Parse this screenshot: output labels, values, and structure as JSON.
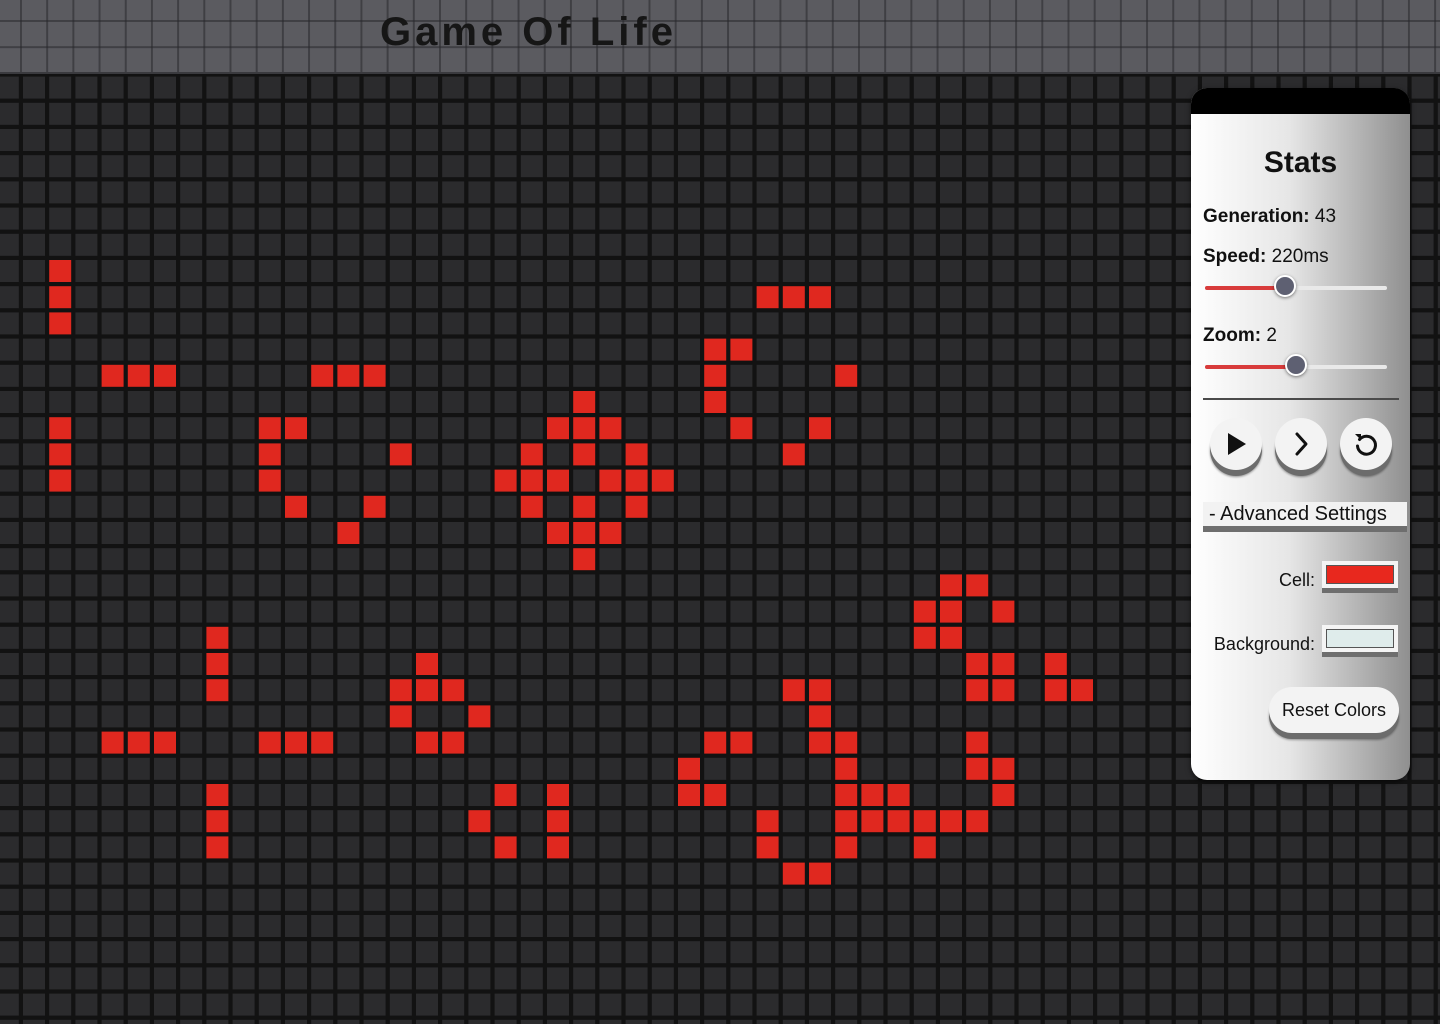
{
  "app": {
    "title": "Game Of Life"
  },
  "grid": {
    "origin_col_offset": 0,
    "cell_color": "#e0281f",
    "dead_color": "#2b2b2d",
    "line_color": "#121212",
    "live_cells": [
      [
        1,
        5
      ],
      [
        1,
        6
      ],
      [
        1,
        7
      ],
      [
        3,
        9
      ],
      [
        4,
        9
      ],
      [
        5,
        9
      ],
      [
        11,
        9
      ],
      [
        12,
        9
      ],
      [
        13,
        9
      ],
      [
        1,
        11
      ],
      [
        1,
        12
      ],
      [
        1,
        13
      ],
      [
        9,
        11
      ],
      [
        10,
        11
      ],
      [
        9,
        12
      ],
      [
        14,
        12
      ],
      [
        9,
        13
      ],
      [
        10,
        14
      ],
      [
        13,
        14
      ],
      [
        12,
        15
      ],
      [
        28,
        6
      ],
      [
        29,
        6
      ],
      [
        30,
        6
      ],
      [
        26,
        8
      ],
      [
        27,
        8
      ],
      [
        26,
        9
      ],
      [
        31,
        9
      ],
      [
        26,
        10
      ],
      [
        27,
        11
      ],
      [
        30,
        11
      ],
      [
        29,
        12
      ],
      [
        21,
        10
      ],
      [
        20,
        11
      ],
      [
        21,
        11
      ],
      [
        22,
        11
      ],
      [
        19,
        12
      ],
      [
        21,
        12
      ],
      [
        23,
        12
      ],
      [
        18,
        13
      ],
      [
        19,
        13
      ],
      [
        20,
        13
      ],
      [
        22,
        13
      ],
      [
        23,
        13
      ],
      [
        24,
        13
      ],
      [
        19,
        14
      ],
      [
        21,
        14
      ],
      [
        23,
        14
      ],
      [
        20,
        15
      ],
      [
        21,
        15
      ],
      [
        22,
        15
      ],
      [
        21,
        16
      ],
      [
        7,
        19
      ],
      [
        7,
        20
      ],
      [
        7,
        21
      ],
      [
        3,
        23
      ],
      [
        4,
        23
      ],
      [
        5,
        23
      ],
      [
        9,
        23
      ],
      [
        10,
        23
      ],
      [
        11,
        23
      ],
      [
        7,
        25
      ],
      [
        7,
        26
      ],
      [
        7,
        27
      ],
      [
        15,
        20
      ],
      [
        14,
        21
      ],
      [
        15,
        21
      ],
      [
        16,
        21
      ],
      [
        14,
        22
      ],
      [
        17,
        22
      ],
      [
        15,
        23
      ],
      [
        16,
        23
      ],
      [
        18,
        25
      ],
      [
        20,
        25
      ],
      [
        17,
        26
      ],
      [
        20,
        26
      ],
      [
        18,
        27
      ],
      [
        20,
        27
      ],
      [
        35,
        17
      ],
      [
        36,
        17
      ],
      [
        34,
        18
      ],
      [
        35,
        18
      ],
      [
        37,
        18
      ],
      [
        34,
        19
      ],
      [
        35,
        19
      ],
      [
        36,
        20
      ],
      [
        37,
        20
      ],
      [
        39,
        20
      ],
      [
        36,
        21
      ],
      [
        37,
        21
      ],
      [
        39,
        21
      ],
      [
        40,
        21
      ],
      [
        29,
        21
      ],
      [
        30,
        21
      ],
      [
        30,
        22
      ],
      [
        26,
        23
      ],
      [
        27,
        23
      ],
      [
        30,
        23
      ],
      [
        31,
        23
      ],
      [
        25,
        24
      ],
      [
        31,
        24
      ],
      [
        25,
        25
      ],
      [
        26,
        25
      ],
      [
        31,
        25
      ],
      [
        32,
        25
      ],
      [
        33,
        25
      ],
      [
        28,
        26
      ],
      [
        31,
        26
      ],
      [
        32,
        26
      ],
      [
        33,
        26
      ],
      [
        34,
        26
      ],
      [
        35,
        26
      ],
      [
        36,
        26
      ],
      [
        28,
        27
      ],
      [
        31,
        27
      ],
      [
        34,
        27
      ],
      [
        29,
        28
      ],
      [
        30,
        28
      ],
      [
        36,
        23
      ],
      [
        36,
        24
      ],
      [
        37,
        24
      ],
      [
        37,
        25
      ]
    ]
  },
  "stats": {
    "title": "Stats",
    "generation_label": "Generation:",
    "generation_value": "43",
    "speed_label": "Speed:",
    "speed_value": "220ms",
    "speed_slider_fraction": 0.44,
    "zoom_label": "Zoom:",
    "zoom_value": "2",
    "zoom_slider_fraction": 0.5
  },
  "controls": {
    "play_icon": "play-icon",
    "step_icon": "chevron-right-icon",
    "reset_icon": "reset-icon"
  },
  "advanced": {
    "toggle_label": "- Advanced Settings",
    "cell_label": "Cell:",
    "cell_color": "#e8281e",
    "background_label": "Background:",
    "background_color": "#dfeceb",
    "reset_colors_label": "Reset Colors"
  }
}
